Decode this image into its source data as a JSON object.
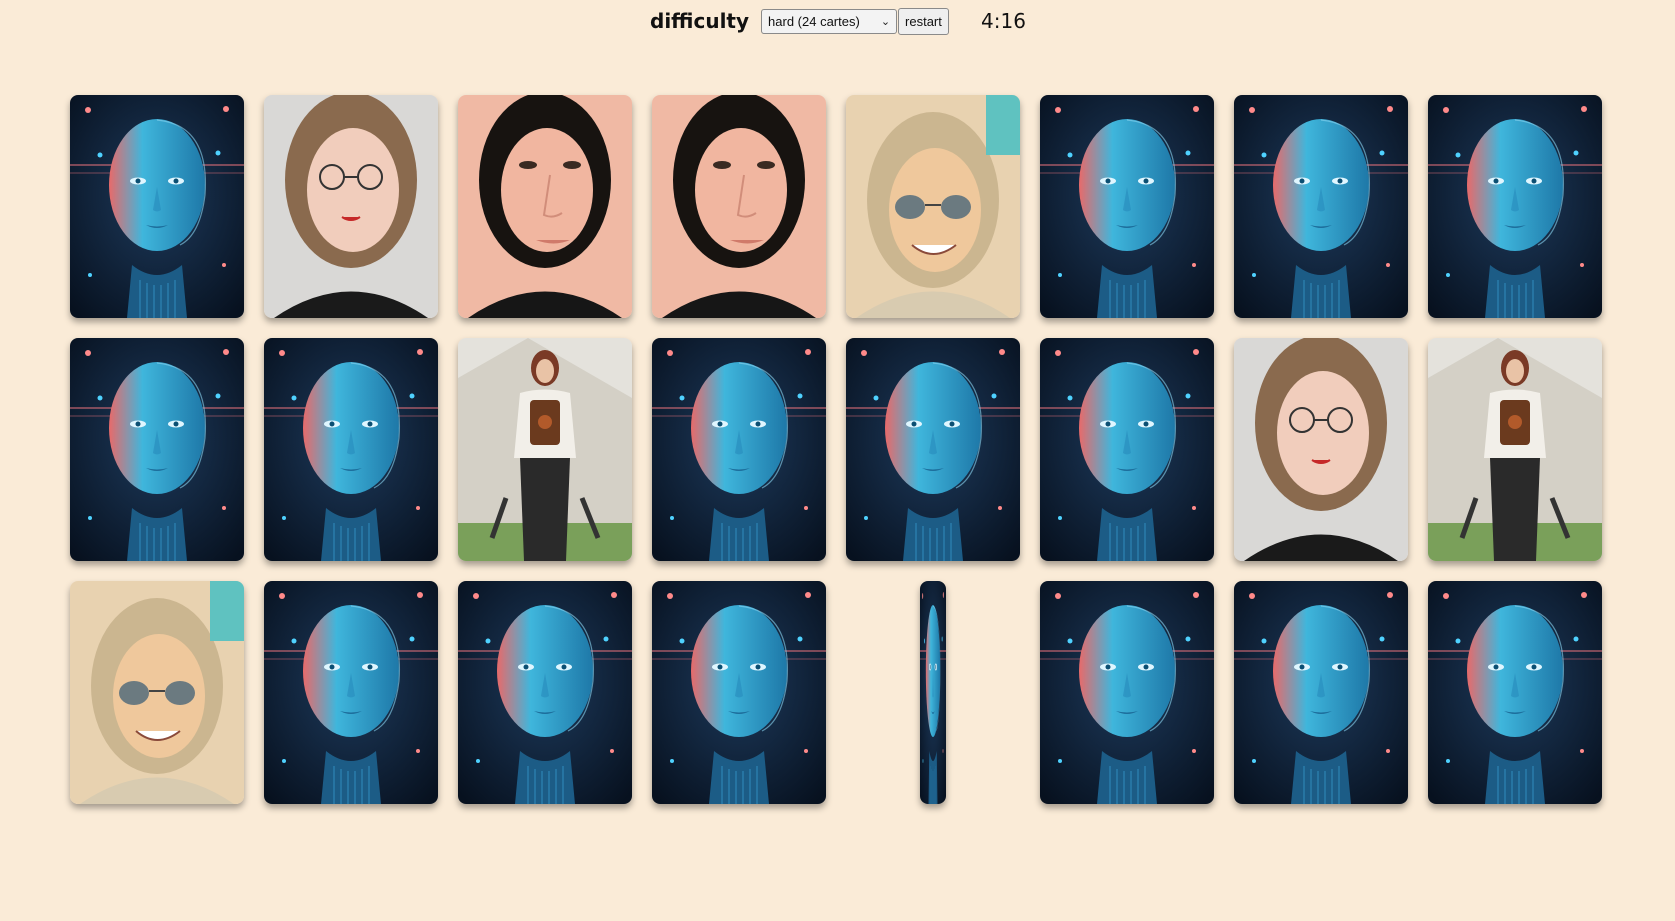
{
  "header": {
    "difficulty_label": "difficulty",
    "difficulty_selected": "hard (24 cartes)",
    "restart_label": "restart",
    "timer": "4:16"
  },
  "colors": {
    "background": "#faebd7",
    "card_back_dark": "#0d1b2e",
    "card_back_face": "#2aa8d4"
  },
  "board": {
    "rows": [
      [
        "back",
        "glasses-woman",
        "dark-hair-woman",
        "dark-hair-woman",
        "sunglasses-woman",
        "back",
        "back",
        "back"
      ],
      [
        "back",
        "back",
        "warrior-woman",
        "back",
        "back",
        "back",
        "glasses-woman",
        "warrior-woman"
      ],
      [
        "sunglasses-woman",
        "back",
        "back",
        "back",
        "flipping",
        "back",
        "back",
        "back"
      ]
    ]
  }
}
